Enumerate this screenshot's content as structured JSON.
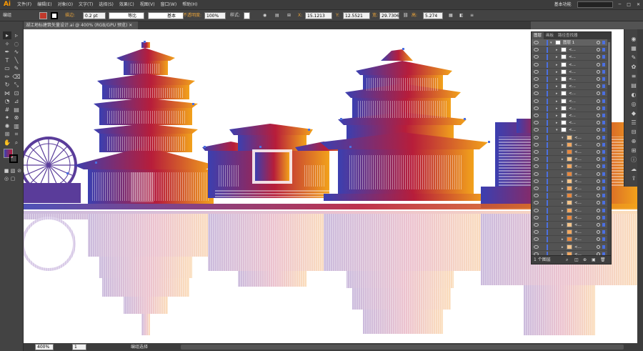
{
  "app": {
    "logo": "Ai"
  },
  "menu": [
    "文件(F)",
    "编辑(E)",
    "对象(O)",
    "文字(T)",
    "选择(S)",
    "效果(C)",
    "视图(V)",
    "窗口(W)",
    "帮助(H)"
  ],
  "workspace": {
    "label": "基本功能",
    "search_placeholder": ""
  },
  "control_bar": {
    "selection_label": "编组",
    "stroke_label": "描边:",
    "stroke_weight": "0.2 pt",
    "stroke_profile": "等比",
    "brush": "基本",
    "opacity_label": "不透明度:",
    "opacity_value": "100%",
    "style_label": "样式:",
    "x_label": "X:",
    "x_value": "15.1213",
    "y_label": "Y:",
    "y_value": "12.5521",
    "w_label": "宽:",
    "w_value": "29.7306",
    "h_label": "高:",
    "h_value": "5.274 m"
  },
  "document_tab": {
    "title": "湖江地标建筑矢量设计.ai @ 400% (RGB/GPU 预览)"
  },
  "status": {
    "zoom": "400%",
    "page": "1",
    "tool_name": "编组选择"
  },
  "layers_panel": {
    "tabs": [
      "图层",
      "画板",
      "路径查找器"
    ],
    "footer": "1 个图层",
    "rows": [
      {
        "name": "图层 1",
        "indent": 0
      },
      {
        "name": "<...",
        "indent": 1
      },
      {
        "name": "<...",
        "indent": 1
      },
      {
        "name": "<...",
        "indent": 1
      },
      {
        "name": "<...",
        "indent": 1
      },
      {
        "name": "<...",
        "indent": 1
      },
      {
        "name": "<...",
        "indent": 1
      },
      {
        "name": "<...",
        "indent": 1
      },
      {
        "name": "<...",
        "indent": 1
      },
      {
        "name": "<...",
        "indent": 1
      },
      {
        "name": "<...",
        "indent": 1
      },
      {
        "name": "<...",
        "indent": 1
      },
      {
        "name": "<...",
        "indent": 1
      },
      {
        "name": "<...",
        "indent": 2
      },
      {
        "name": "<...",
        "indent": 2
      },
      {
        "name": "<...",
        "indent": 2
      },
      {
        "name": "<...",
        "indent": 2
      },
      {
        "name": "<...",
        "indent": 2
      },
      {
        "name": "<...",
        "indent": 2
      },
      {
        "name": "<...",
        "indent": 2
      },
      {
        "name": "<...",
        "indent": 2
      },
      {
        "name": "<...",
        "indent": 2
      },
      {
        "name": "<...",
        "indent": 2
      },
      {
        "name": "<...",
        "indent": 2
      },
      {
        "name": "<...",
        "indent": 2
      },
      {
        "name": "<...",
        "indent": 2
      },
      {
        "name": "<...",
        "indent": 2
      },
      {
        "name": "<...",
        "indent": 2
      },
      {
        "name": "<...",
        "indent": 2
      },
      {
        "name": "<...",
        "indent": 2
      }
    ]
  },
  "colors": {
    "fill_swatch": "#c0392b",
    "stroke_swatch": "#000000",
    "gradient_start": "#3b3fb0",
    "gradient_mid": "#b71d3a",
    "gradient_end": "#f2a21b",
    "selection": "#4b6fe0"
  }
}
